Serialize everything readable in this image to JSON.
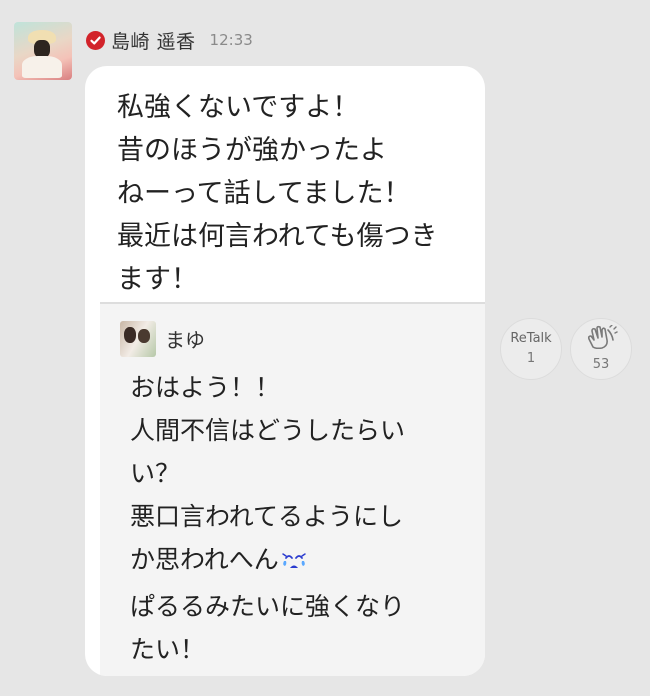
{
  "post": {
    "author": "島崎 遥香",
    "time": "12:33",
    "text": "私強くないですよ！\n昔のほうが強かったよ\nねーって話してました！\n最近は何言われても傷つき\nます！",
    "quote": {
      "author": "まゆ",
      "text_main": "おはよう！！\n人間不信はどうしたらい\nい？\n悪口言われてるようにし\nか思われへん",
      "emoji": "crying-face-emoji",
      "text_end": "ぱるるみたいに強くなり\nたい！"
    }
  },
  "actions": {
    "retalk_label": "ReTalk",
    "retalk_count": "1",
    "clap_count": "53"
  },
  "colors": {
    "background": "#e6e6e6",
    "verified_badge": "#d2232a",
    "bubble": "#ffffff",
    "quote_bg": "#f4f4f4"
  }
}
